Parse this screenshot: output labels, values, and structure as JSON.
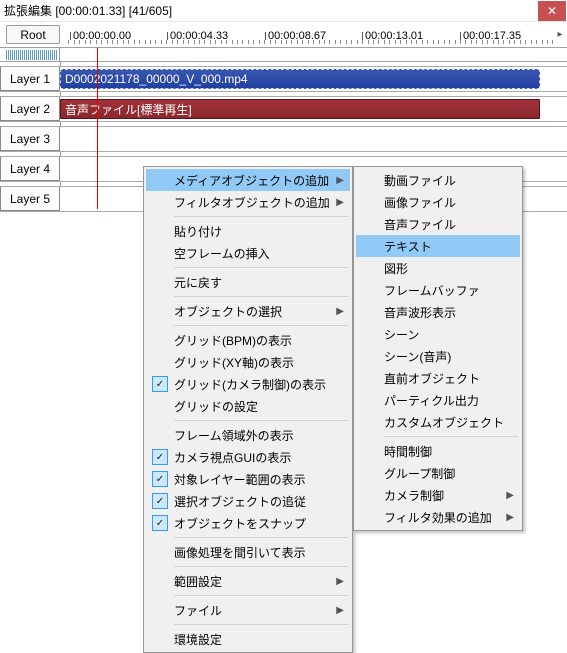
{
  "window": {
    "title": "拡張編集 [00:00:01.33] [41/605]"
  },
  "toolbar": {
    "root": "Root"
  },
  "ruler": [
    "00:00:00.00",
    "00:00:04.33",
    "00:00:08.67",
    "00:00:13.01",
    "00:00:17.35"
  ],
  "layers": [
    "Layer 1",
    "Layer 2",
    "Layer 3",
    "Layer 4",
    "Layer 5"
  ],
  "clips": {
    "video": "D0002021178_00000_V_000.mp4",
    "audio": "音声ファイル[標準再生]"
  },
  "menu1": [
    {
      "t": "item",
      "label": "メディアオブジェクトの追加",
      "hi": true,
      "sub": true
    },
    {
      "t": "item",
      "label": "フィルタオブジェクトの追加",
      "sub": true
    },
    {
      "t": "sep"
    },
    {
      "t": "item",
      "label": "貼り付け"
    },
    {
      "t": "item",
      "label": "空フレームの挿入"
    },
    {
      "t": "sep"
    },
    {
      "t": "item",
      "label": "元に戻す"
    },
    {
      "t": "sep"
    },
    {
      "t": "item",
      "label": "オブジェクトの選択",
      "dis": true,
      "sub": true
    },
    {
      "t": "sep"
    },
    {
      "t": "item",
      "label": "グリッド(BPM)の表示"
    },
    {
      "t": "item",
      "label": "グリッド(XY軸)の表示"
    },
    {
      "t": "item",
      "label": "グリッド(カメラ制御)の表示",
      "chk": true
    },
    {
      "t": "item",
      "label": "グリッドの設定"
    },
    {
      "t": "sep"
    },
    {
      "t": "item",
      "label": "フレーム領域外の表示"
    },
    {
      "t": "item",
      "label": "カメラ視点GUIの表示",
      "chk": true
    },
    {
      "t": "item",
      "label": "対象レイヤー範囲の表示",
      "chk": true
    },
    {
      "t": "item",
      "label": "選択オブジェクトの追従",
      "chk": true
    },
    {
      "t": "item",
      "label": "オブジェクトをスナップ",
      "chk": true
    },
    {
      "t": "sep"
    },
    {
      "t": "item",
      "label": "画像処理を間引いて表示"
    },
    {
      "t": "sep"
    },
    {
      "t": "item",
      "label": "範囲設定",
      "sub": true
    },
    {
      "t": "sep"
    },
    {
      "t": "item",
      "label": "ファイル",
      "sub": true
    },
    {
      "t": "sep"
    },
    {
      "t": "item",
      "label": "環境設定"
    }
  ],
  "menu2": [
    {
      "t": "item",
      "label": "動画ファイル"
    },
    {
      "t": "item",
      "label": "画像ファイル"
    },
    {
      "t": "item",
      "label": "音声ファイル"
    },
    {
      "t": "item",
      "label": "テキスト",
      "hi": true
    },
    {
      "t": "item",
      "label": "図形"
    },
    {
      "t": "item",
      "label": "フレームバッファ"
    },
    {
      "t": "item",
      "label": "音声波形表示"
    },
    {
      "t": "item",
      "label": "シーン"
    },
    {
      "t": "item",
      "label": "シーン(音声)"
    },
    {
      "t": "item",
      "label": "直前オブジェクト"
    },
    {
      "t": "item",
      "label": "パーティクル出力"
    },
    {
      "t": "item",
      "label": "カスタムオブジェクト"
    },
    {
      "t": "sep"
    },
    {
      "t": "item",
      "label": "時間制御"
    },
    {
      "t": "item",
      "label": "グループ制御"
    },
    {
      "t": "item",
      "label": "カメラ制御",
      "sub": true
    },
    {
      "t": "item",
      "label": "フィルタ効果の追加",
      "sub": true
    }
  ]
}
